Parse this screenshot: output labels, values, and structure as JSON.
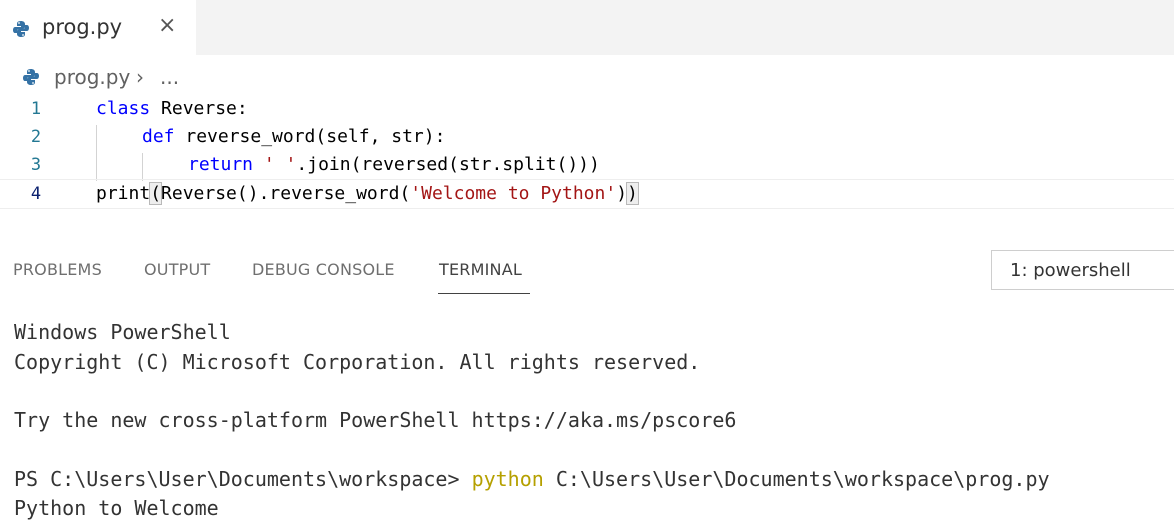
{
  "tab": {
    "filename": "prog.py",
    "close_glyph": "×"
  },
  "breadcrumb": {
    "file": "prog.py",
    "separator": "›",
    "more": "..."
  },
  "editor": {
    "line_numbers": [
      "1",
      "2",
      "3",
      "4"
    ],
    "lines": {
      "l1_kw": "class",
      "l1_rest": " Reverse:",
      "l2_kw": "def",
      "l2_rest": " reverse_word(self, str):",
      "l3_kw": "return",
      "l3_str": "' '",
      "l3_rest": ".join(reversed(str.split()))",
      "l4_a": "print",
      "l4_paren_open": "(",
      "l4_b": "Reverse().reverse_word(",
      "l4_str": "'Welcome to Python'",
      "l4_c": ")",
      "l4_paren_close": ")"
    }
  },
  "panel": {
    "tabs": [
      "PROBLEMS",
      "OUTPUT",
      "DEBUG CONSOLE",
      "TERMINAL"
    ],
    "active_tab": "TERMINAL",
    "shell_select": "1: powershell"
  },
  "terminal": {
    "line1": "Windows PowerShell",
    "line2": "Copyright (C) Microsoft Corporation. All rights reserved.",
    "line3": "Try the new cross-platform PowerShell https://aka.ms/pscore6",
    "prompt": "PS C:\\Users\\User\\Documents\\workspace> ",
    "command": "python",
    "args": " C:\\Users\\User\\Documents\\workspace\\prog.py",
    "output": "Python to Welcome"
  },
  "colors": {
    "keyword": "#0000ff",
    "string": "#a31515",
    "command": "#b5a000",
    "line_number": "#237893"
  },
  "icons": {
    "file_icon": "python-icon",
    "close": "close-icon"
  }
}
